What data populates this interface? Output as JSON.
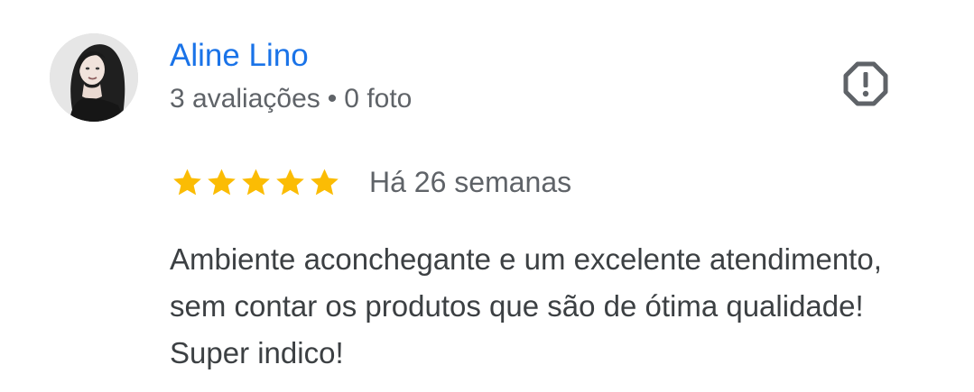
{
  "review": {
    "reviewer_name": "Aline Lino",
    "review_count": "3 avaliações",
    "separator": "•",
    "photo_count": "0 foto",
    "rating": 5,
    "rating_max": 5,
    "date": "Há 26 semanas",
    "text": "Ambiente aconchegante e um excelente atendimento, sem contar os produtos que são de ótima qualidade! Super indico!"
  },
  "icons": {
    "report": "report-flag-icon",
    "star": "star-icon",
    "avatar": "avatar-photo"
  },
  "colors": {
    "name": "#1a73e8",
    "star": "#fbbc04",
    "meta": "#5f6368",
    "body_text": "#3c4043"
  }
}
